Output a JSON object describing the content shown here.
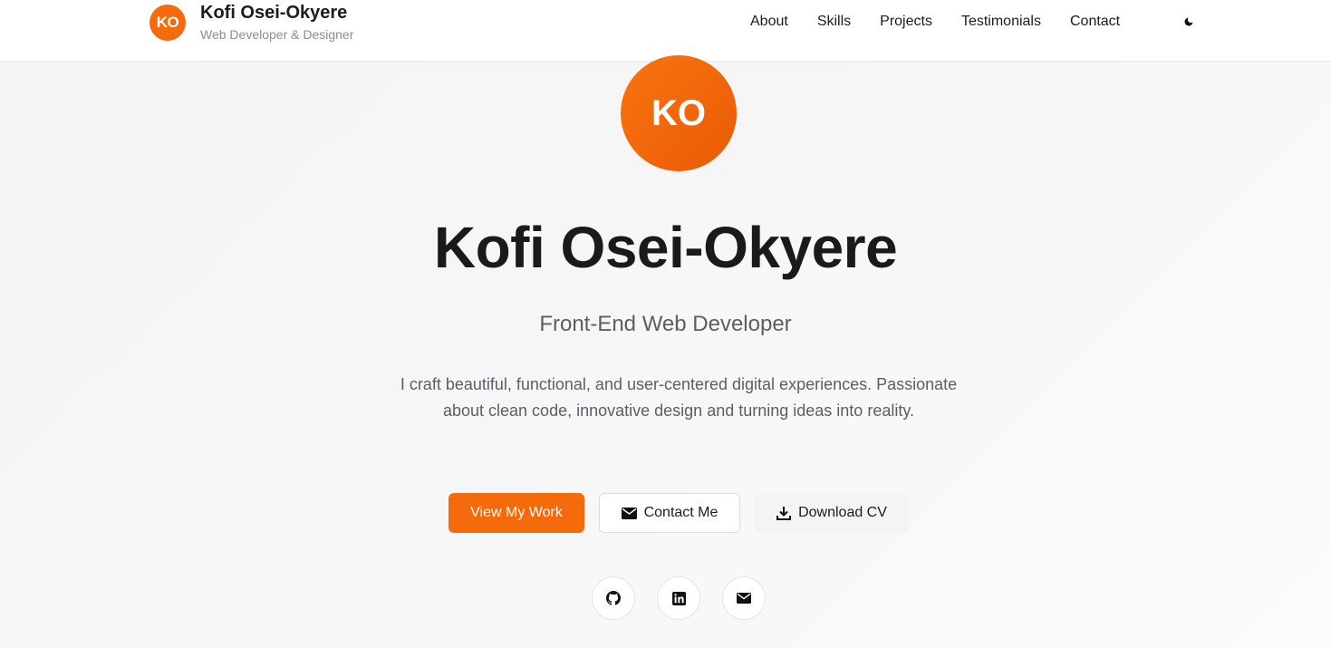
{
  "header": {
    "logo_initials": "KO",
    "name": "Kofi Osei-Okyere",
    "subtitle": "Web Developer & Designer",
    "nav": [
      "About",
      "Skills",
      "Projects",
      "Testimonials",
      "Contact"
    ],
    "theme_toggle_icon": "moon-icon"
  },
  "hero": {
    "avatar_initials": "KO",
    "name": "Kofi Osei-Okyere",
    "role": "Front-End Web Developer",
    "description": "I craft beautiful, functional, and user-centered digital experiences. Passionate about clean code, innovative design and turning ideas into reality.",
    "buttons": {
      "primary": "View My Work",
      "contact": "Contact Me",
      "download": "Download CV"
    },
    "socials": [
      "github-icon",
      "linkedin-icon",
      "email-icon"
    ]
  },
  "colors": {
    "accent": "#f56a0a",
    "text": "#1c1c1c",
    "muted": "#5b5e63"
  }
}
